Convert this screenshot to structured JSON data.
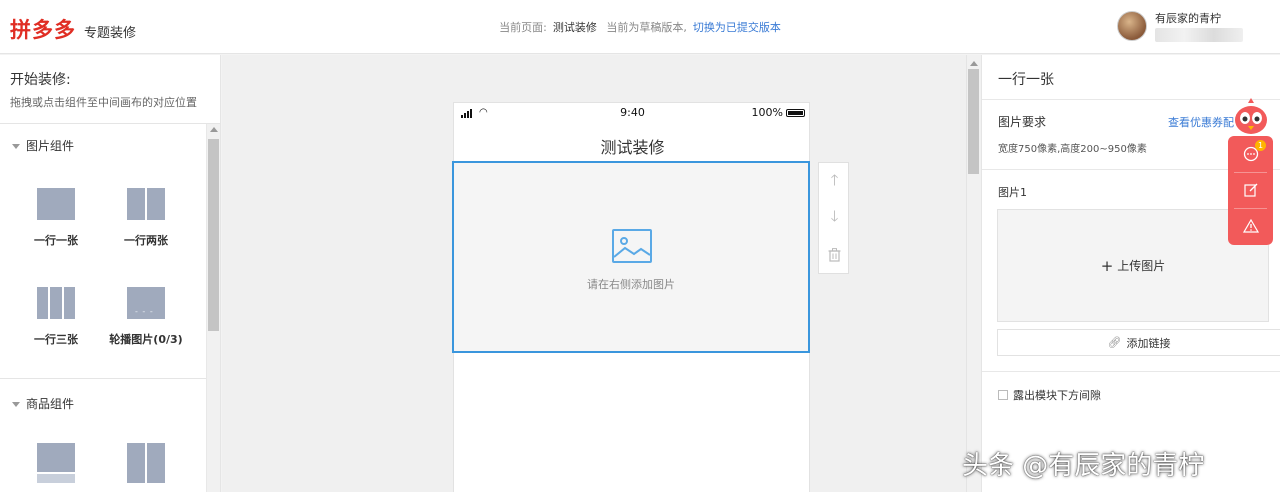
{
  "header": {
    "logo": "拼多多",
    "logo_sub": "专题装修",
    "current_page_label": "当前页面:",
    "current_page_name": "测试装修",
    "draft_status": "当前为草稿版本,",
    "switch_link": "切换为已提交版本",
    "user_name": "有辰家的青柠"
  },
  "left_panel": {
    "title": "开始装修:",
    "desc": "拖拽或点击组件至中间画布的对应位置",
    "groups": [
      {
        "name": "图片组件",
        "items": [
          {
            "label": "一行一张"
          },
          {
            "label": "一行两张"
          },
          {
            "label": "一行三张"
          },
          {
            "label": "轮播图片(0/3)"
          }
        ]
      },
      {
        "name": "商品组件"
      }
    ]
  },
  "phone": {
    "time": "9:40",
    "battery": "100%",
    "title": "测试装修",
    "image_hint": "请在右侧添加图片"
  },
  "right_panel": {
    "title": "一行一张",
    "req_label": "图片要求",
    "coupon_link": "查看优惠券配",
    "size_desc": "宽度750像素,高度200~950像素",
    "image_label": "图片1",
    "upload_label": "上传图片",
    "link_label": "添加链接",
    "spacing_label": "露出模块下方间隙"
  },
  "float_helper": {
    "badge": "1"
  },
  "watermark": "头条 @有辰家的青柠",
  "colors": {
    "brand_red": "#e02e24",
    "accent_blue": "#3a96dd",
    "link_blue": "#3a7bd5",
    "helper_red": "#f25a5a"
  }
}
